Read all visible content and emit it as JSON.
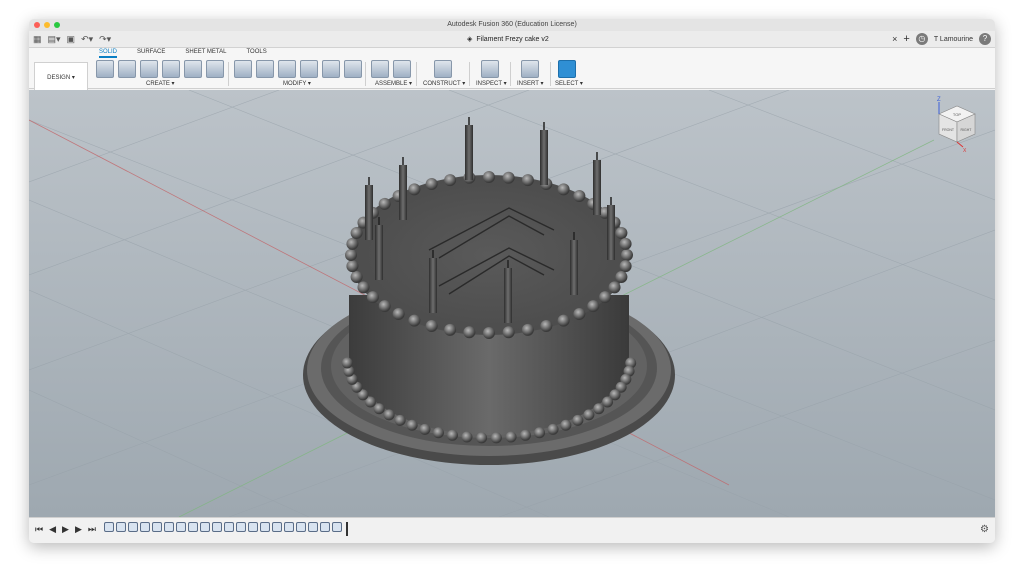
{
  "app": {
    "window_title": "Autodesk Fusion 360 (Education License)",
    "document_title": "Filament Frezy cake v2",
    "user": "T Lamourine"
  },
  "ribbon": {
    "workspace": "DESIGN ▾",
    "tabs": [
      "SOLID",
      "SURFACE",
      "SHEET METAL",
      "TOOLS"
    ],
    "active_tab": "SOLID",
    "groups": [
      "CREATE ▾",
      "MODIFY ▾",
      "ASSEMBLE ▾",
      "CONSTRUCT ▾",
      "INSPECT ▾",
      "INSERT ▾",
      "SELECT ▾"
    ]
  },
  "viewcube": {
    "top": "TOP",
    "front": "FRONT",
    "right": "RIGHT",
    "axis_z": "Z",
    "axis_x": "X"
  },
  "icons": {
    "grid": "grid-icon",
    "file": "file-icon",
    "save": "save-icon",
    "undo": "undo-icon",
    "redo": "redo-icon",
    "close": "close-icon",
    "new_tab": "plus-icon",
    "clock": "clock-icon",
    "help": "help-icon",
    "settings": "gear-icon"
  },
  "colors": {
    "accent": "#0a7fc4",
    "viewport_bg": "#aeb7be",
    "model": "#505050"
  }
}
